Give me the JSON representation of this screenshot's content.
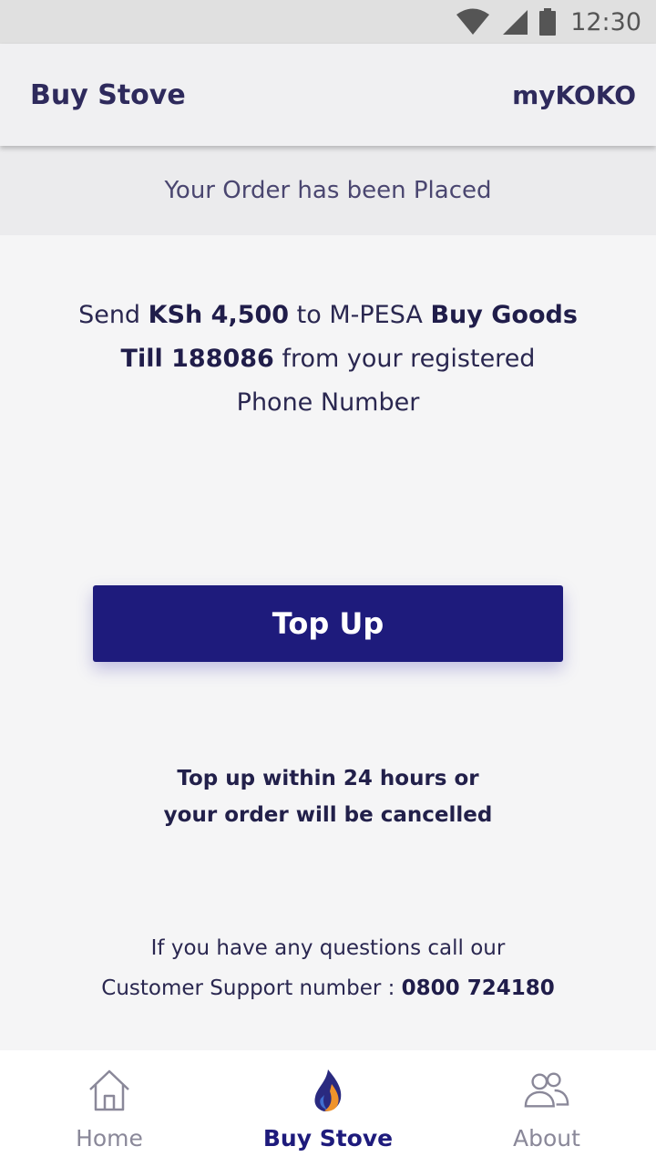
{
  "status_bar": {
    "time": "12:30",
    "icons": [
      "wifi-icon",
      "signal-icon",
      "battery-icon"
    ]
  },
  "app_bar": {
    "title": "Buy Stove",
    "brand": "myKOKO"
  },
  "banner": {
    "text": "Your Order has been Placed"
  },
  "instructions": {
    "send": "Send",
    "amount": "KSh 4,500",
    "to": "to M-PESA",
    "buy_goods": "Buy Goods",
    "till": "Till 188086",
    "from": "from your registered",
    "phone": "Phone Number"
  },
  "top_up_button": {
    "label": "Top Up"
  },
  "warning": {
    "line1": "Top up within 24 hours or",
    "line2": "your order will be cancelled"
  },
  "support": {
    "line1": "If you have any questions call our",
    "line2_prefix": "Customer Support number :",
    "number": "0800 724180"
  },
  "bottom_nav": {
    "items": [
      {
        "label": "Home",
        "icon": "home-icon",
        "active": false
      },
      {
        "label": "Buy Stove",
        "icon": "flame-icon",
        "active": true
      },
      {
        "label": "About",
        "icon": "people-icon",
        "active": false
      }
    ]
  },
  "colors": {
    "primary": "#1e1b7c",
    "text_dark": "#2e2a5c",
    "nav_inactive": "#8a8899",
    "flame_blue": "#2a2a80",
    "flame_orange": "#f0932b"
  }
}
